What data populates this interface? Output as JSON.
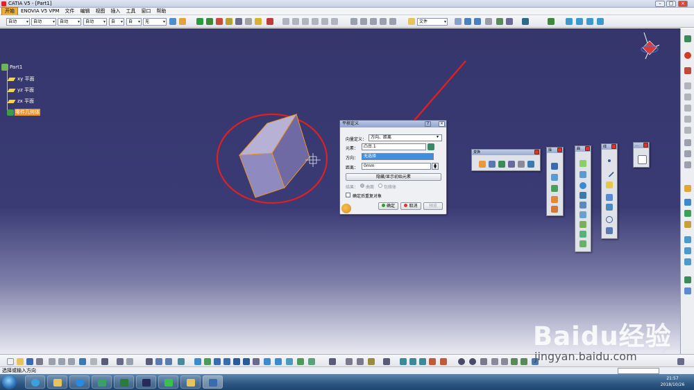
{
  "window": {
    "title": "CATIA V5 - [Part1]"
  },
  "menu": [
    "开始",
    "ENOVIA V5 VPM",
    "文件",
    "编辑",
    "视图",
    "插入",
    "工具",
    "窗口",
    "帮助"
  ],
  "toolbar": {
    "combos": [
      "自动",
      "自动",
      "自动",
      "自动",
      "自",
      "自",
      "无"
    ],
    "file_combo": "文件"
  },
  "tree": {
    "root": "Part1",
    "planes": [
      "xy 平面",
      "yz 平面",
      "zx 平面"
    ],
    "body": "零件几何体"
  },
  "dialog": {
    "title": "平移定义",
    "vector_label": "向量定义：",
    "vector_value": "方向、距离",
    "element_label": "元素：",
    "element_value": "凸台.1",
    "direction_label": "方向：",
    "direction_value": "无选择",
    "distance_label": "距离：",
    "distance_value": "0mm",
    "hide_show_button": "隐藏/显示初始元素",
    "result_label": "结果：",
    "result_option1": "曲面",
    "result_option2": "包络体",
    "repeat_label": "确定后重复对象",
    "ok": "确定",
    "cancel": "取消",
    "preview": "预览"
  },
  "panels": {
    "transform": "变换",
    "p2": "操",
    "p3": "曲",
    "p4": "线",
    "p5": "…"
  },
  "status": {
    "text": "选择或输入方向"
  },
  "taskbar": {
    "time": "21:57",
    "date": "2018/10/26"
  },
  "watermark": {
    "brand": "Baidu经验",
    "url": "jingyan.baidu.com"
  },
  "colors": {
    "viewport_top": "#35366c",
    "selection": "#ef9322",
    "annotation": "#e02020"
  }
}
